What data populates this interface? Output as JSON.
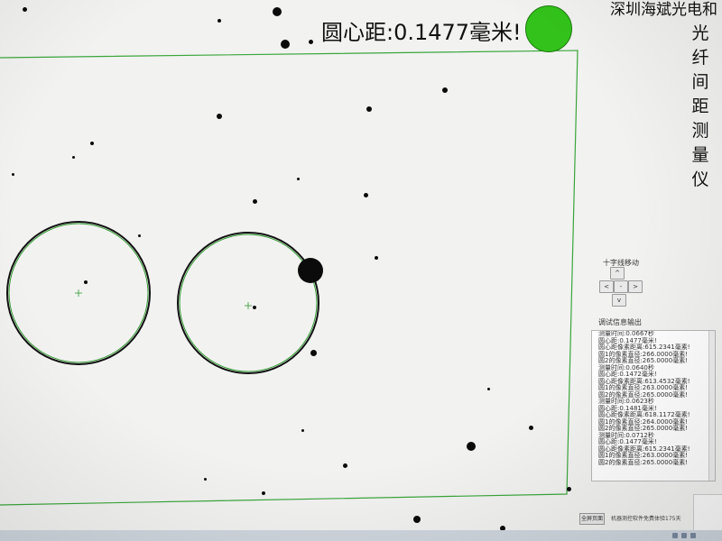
{
  "header": {
    "measurement_label": "圆心距:0.1477毫米!",
    "status_color": "#33c21b",
    "company": "深圳海斌光电和",
    "app_title_chars": [
      "光",
      "纤",
      "间",
      "距",
      "测",
      "量",
      "仪"
    ]
  },
  "crosshair_panel": {
    "title": "十字线移动",
    "up": "^",
    "left": "<",
    "center": "-",
    "right": ">",
    "down": "v"
  },
  "debug_panel": {
    "title": "调试信息输出",
    "lines": [
      "测量时间:0.0667秒",
      "圆心距:0.1477毫米!",
      "圆心距像素距离:615.2341毫素!",
      "圆1的像素直径:266.0000毫素!",
      "圆2的像素直径:265.0000毫素!",
      "测量时间:0.0640秒",
      "圆心距:0.1472毫米!",
      "圆心距像素距离:613.4532毫素!",
      "圆1的像素直径:263.0000毫素!",
      "圆2的像素直径:265.0000毫素!",
      "测量时间:0.0623秒",
      "圆心距:0.1481毫米!",
      "圆心距像素距离:618.1172毫素!",
      "圆1的像素直径:264.0000毫素!",
      "圆2的像素直径:265.0000毫素!",
      "测量时间:0.0712秒",
      "圆心距:0.1477毫米!",
      "圆心距像素距离:615.2341毫素!",
      "圆1的像素直径:263.0000毫素!",
      "圆2的像素直径:265.0000毫素!"
    ]
  },
  "footer": {
    "button_label": "全屏页面",
    "status_text": "机器测控软件免费体验175天"
  },
  "colors": {
    "roi_outline": "#3aa63a",
    "fit_circle": "#2f9a2f",
    "fiber_edge": "#111111"
  },
  "icons": {
    "status_light": "status-indicator-icon",
    "center_marker": "crosshair-icon"
  }
}
